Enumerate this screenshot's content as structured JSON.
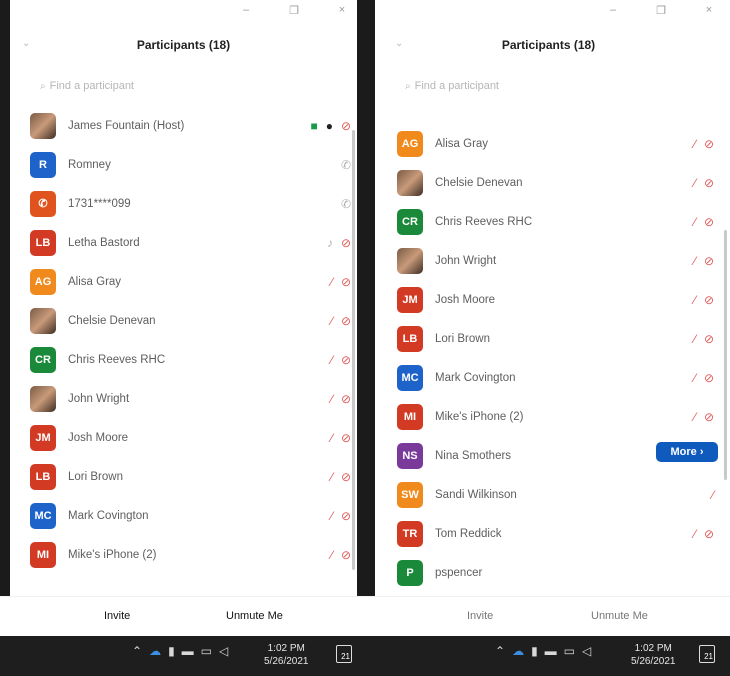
{
  "window_controls": {
    "minimize": "–",
    "restore": "❐",
    "close": "×"
  },
  "left_panel": {
    "title": "Participants (18)",
    "search_placeholder": "Find a participant",
    "participants": [
      {
        "name": "James Fountain (Host)",
        "initials": "",
        "avatar_color": "",
        "photo": true,
        "status": "host"
      },
      {
        "name": "Romney",
        "initials": "R",
        "avatar_color": "#1e63c9",
        "status": "phone"
      },
      {
        "name": "1731****099",
        "initials": "✆",
        "avatar_color": "#e0531f",
        "status": "phone"
      },
      {
        "name": "Letha Bastord",
        "initials": "LB",
        "avatar_color": "#d23a24",
        "status": "mic-idle"
      },
      {
        "name": "Alisa Gray",
        "initials": "AG",
        "avatar_color": "#f08a1d",
        "status": "muted"
      },
      {
        "name": "Chelsie Denevan",
        "initials": "",
        "avatar_color": "",
        "photo": true,
        "status": "muted"
      },
      {
        "name": "Chris Reeves RHC",
        "initials": "CR",
        "avatar_color": "#1a8a3a",
        "status": "muted"
      },
      {
        "name": "John Wright",
        "initials": "",
        "avatar_color": "",
        "photo": true,
        "status": "muted"
      },
      {
        "name": "Josh Moore",
        "initials": "JM",
        "avatar_color": "#d23a24",
        "status": "muted"
      },
      {
        "name": "Lori Brown",
        "initials": "LB",
        "avatar_color": "#d23a24",
        "status": "muted"
      },
      {
        "name": "Mark Covington",
        "initials": "MC",
        "avatar_color": "#1e63c9",
        "status": "muted"
      },
      {
        "name": "Mike's iPhone (2)",
        "initials": "MI",
        "avatar_color": "#d23a24",
        "status": "muted"
      }
    ],
    "invite_label": "Invite",
    "unmute_label": "Unmute Me",
    "clock_time": "1:02 PM",
    "clock_date": "5/26/2021",
    "notif_count": "21"
  },
  "right_panel": {
    "title": "Participants (18)",
    "search_placeholder": "Find a participant",
    "participants": [
      {
        "name": "Alisa Gray",
        "initials": "AG",
        "avatar_color": "#f08a1d",
        "status": "muted"
      },
      {
        "name": "Chelsie Denevan",
        "initials": "",
        "avatar_color": "",
        "photo": true,
        "status": "muted"
      },
      {
        "name": "Chris Reeves RHC",
        "initials": "CR",
        "avatar_color": "#1a8a3a",
        "status": "muted"
      },
      {
        "name": "John Wright",
        "initials": "",
        "avatar_color": "",
        "photo": true,
        "status": "muted"
      },
      {
        "name": "Josh Moore",
        "initials": "JM",
        "avatar_color": "#d23a24",
        "status": "muted"
      },
      {
        "name": "Lori Brown",
        "initials": "LB",
        "avatar_color": "#d23a24",
        "status": "muted"
      },
      {
        "name": "Mark Covington",
        "initials": "MC",
        "avatar_color": "#1e63c9",
        "status": "muted"
      },
      {
        "name": "Mike's iPhone (2)",
        "initials": "MI",
        "avatar_color": "#d23a24",
        "status": "muted"
      },
      {
        "name": "Nina Smothers",
        "initials": "NS",
        "avatar_color": "#7a3a9a",
        "status": "more"
      },
      {
        "name": "Sandi Wilkinson",
        "initials": "SW",
        "avatar_color": "#f08a1d",
        "status": "mic-only"
      },
      {
        "name": "Tom Reddick",
        "initials": "TR",
        "avatar_color": "#d23a24",
        "status": "muted"
      },
      {
        "name": "pspencer",
        "initials": "P",
        "avatar_color": "#1a8a3a",
        "status": "none"
      }
    ],
    "more_label": "More ›",
    "invite_label": "Invite",
    "unmute_label": "Unmute Me",
    "clock_time": "1:02 PM",
    "clock_date": "5/26/2021",
    "notif_count": "21"
  },
  "icons": {
    "mic_off": "🎙",
    "cam_off": "▭",
    "phone": "✆"
  }
}
